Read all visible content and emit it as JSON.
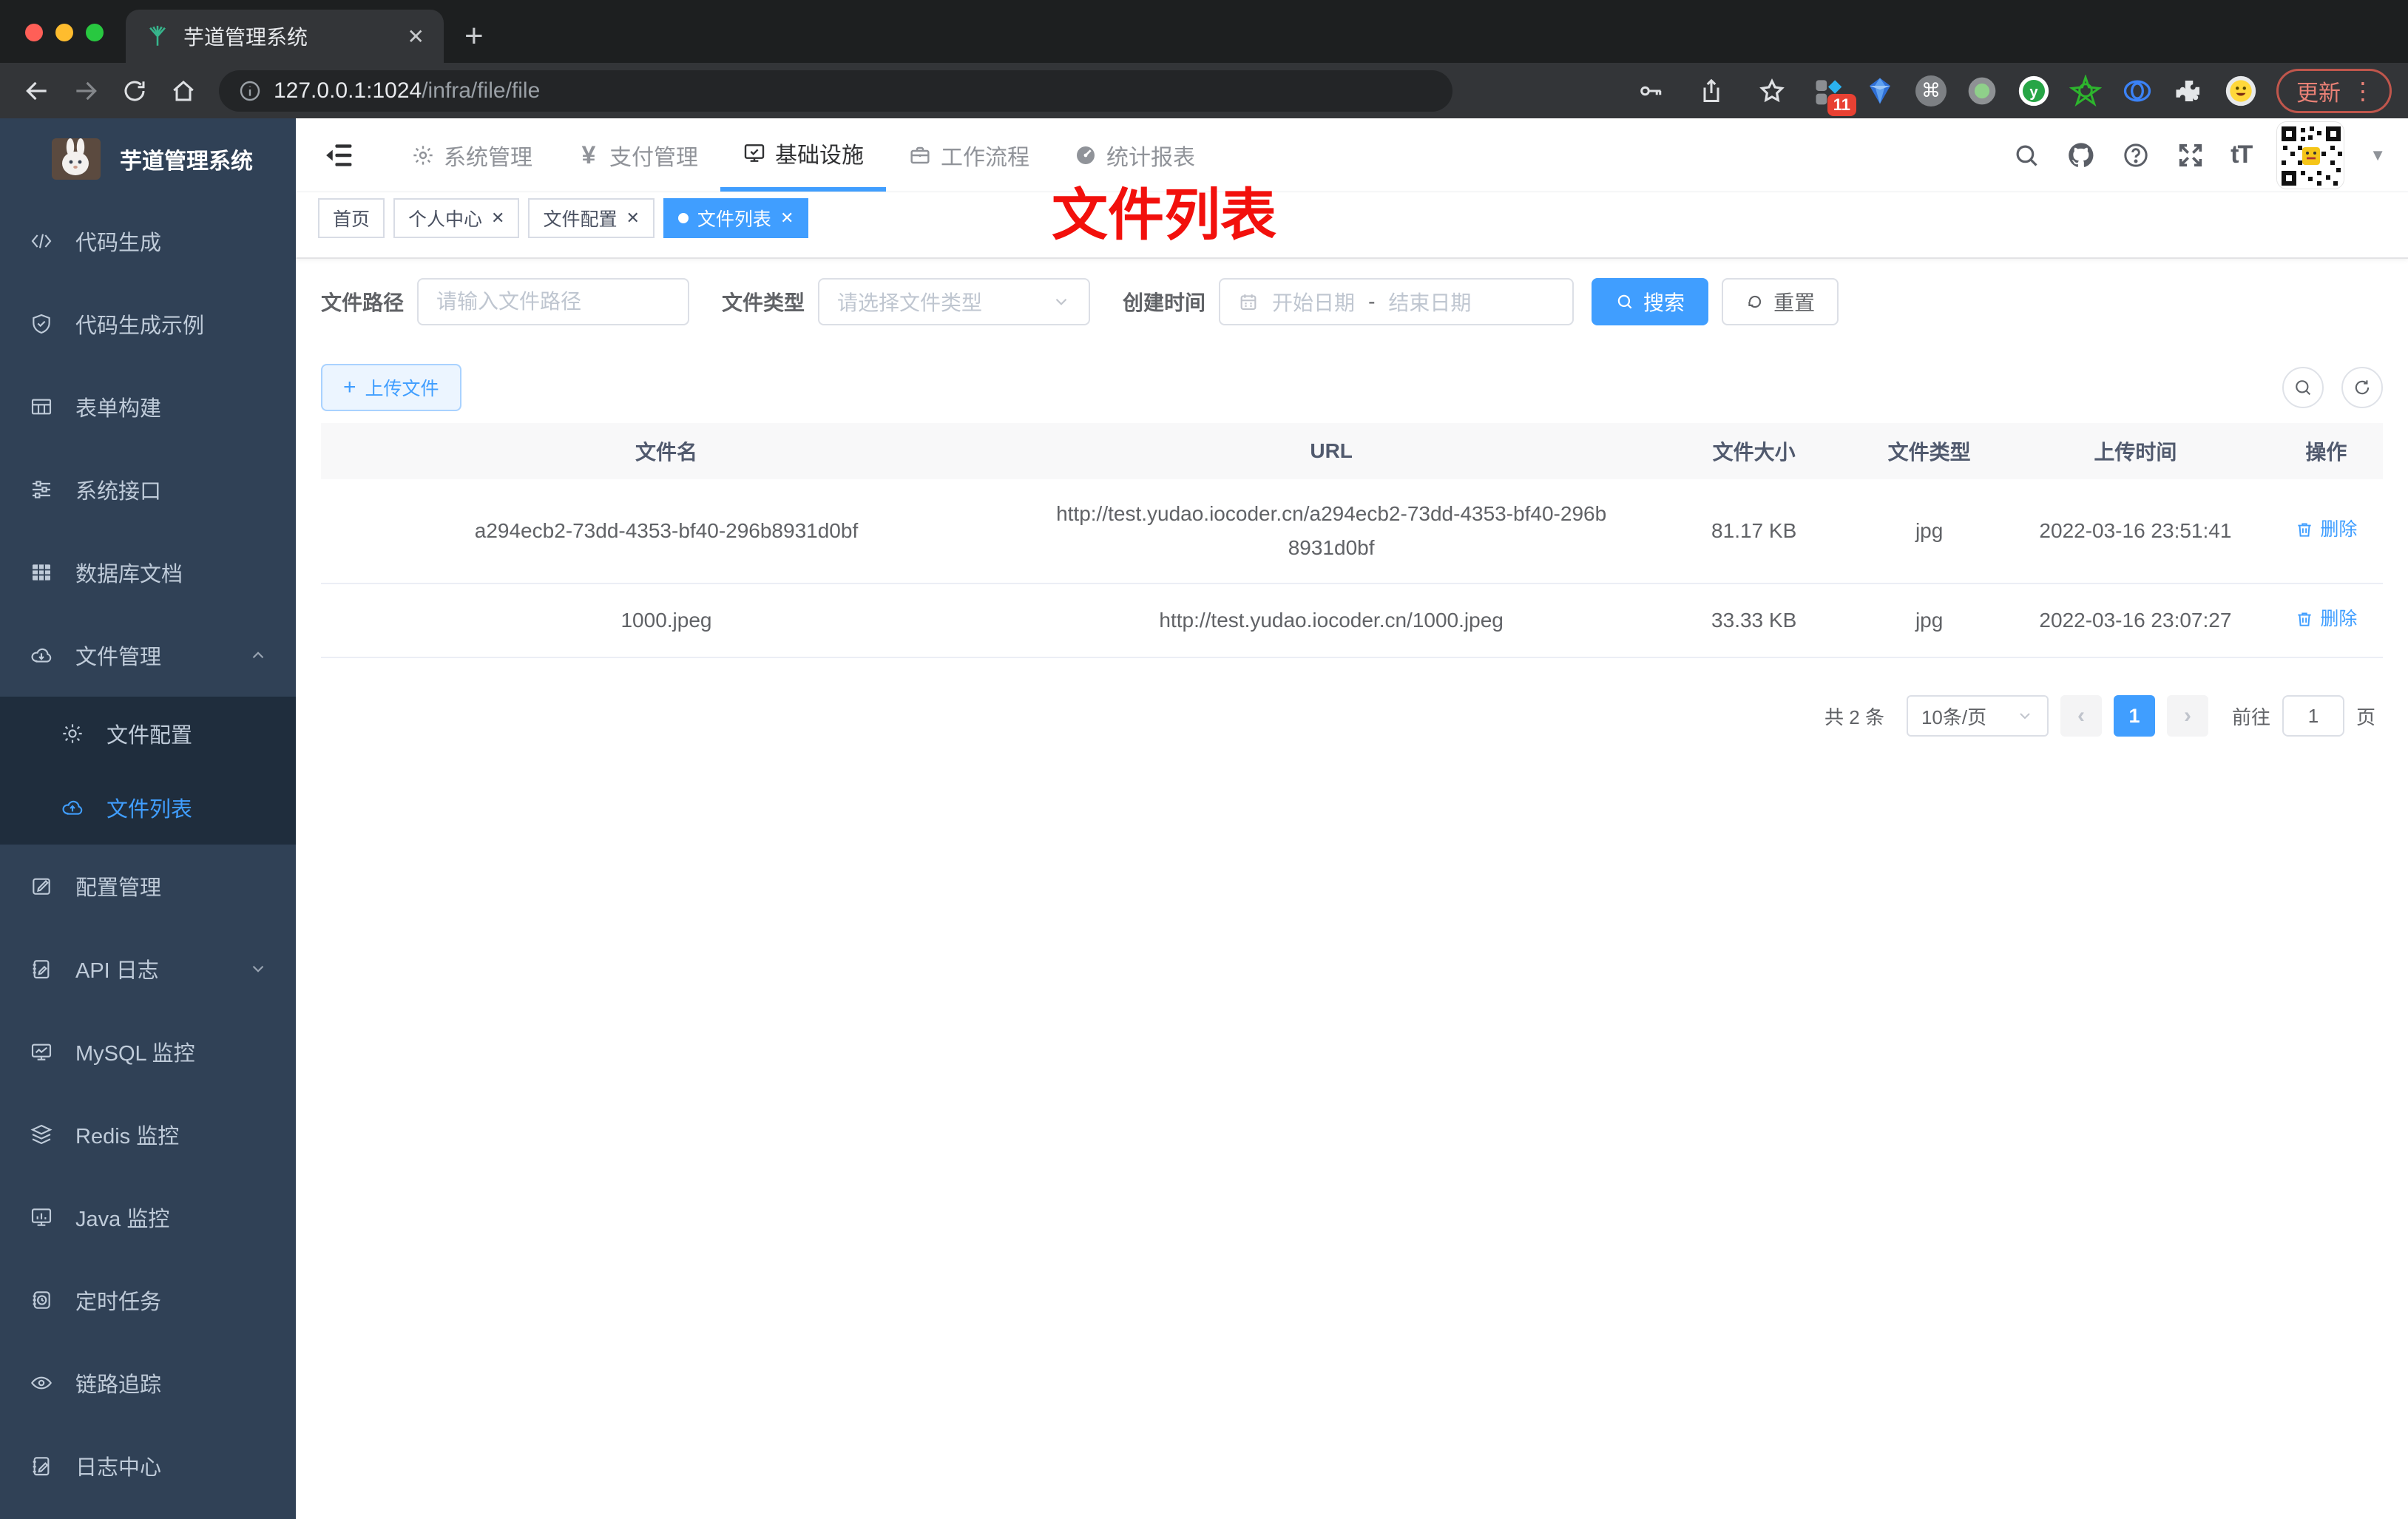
{
  "colors": {
    "accent": "#409eff",
    "sidebar_bg": "#304156",
    "submenu_bg": "#1f2d3d",
    "annotation_red": "#f2100c",
    "update_red": "#ea8176"
  },
  "icons": {
    "close": "✕",
    "plus": "+",
    "prev": "‹",
    "next": "›",
    "caret_down": "▼",
    "kebab": "⋮",
    "yen": "¥",
    "font_size": "tT",
    "command": "⌘",
    "letter_y": "y",
    "info": "i"
  },
  "browser": {
    "tab_title": "芋道管理系统",
    "url_host": "127.0.0.1:1024",
    "url_path": "/infra/file/file",
    "ext_badge": "11",
    "update_label": "更新"
  },
  "sidebar": {
    "title": "芋道管理系统",
    "items": [
      {
        "label": "代码生成"
      },
      {
        "label": "代码生成示例"
      },
      {
        "label": "表单构建"
      },
      {
        "label": "系统接口"
      },
      {
        "label": "数据库文档"
      },
      {
        "label": "文件管理"
      },
      {
        "label": "文件配置"
      },
      {
        "label": "文件列表"
      },
      {
        "label": "配置管理"
      },
      {
        "label": "API 日志"
      },
      {
        "label": "MySQL 监控"
      },
      {
        "label": "Redis 监控"
      },
      {
        "label": "Java 监控"
      },
      {
        "label": "定时任务"
      },
      {
        "label": "链路追踪"
      },
      {
        "label": "日志中心"
      }
    ]
  },
  "topnav": {
    "items": [
      {
        "label": "系统管理"
      },
      {
        "label": "支付管理"
      },
      {
        "label": "基础设施"
      },
      {
        "label": "工作流程"
      },
      {
        "label": "统计报表"
      }
    ]
  },
  "tabs": [
    {
      "label": "首页"
    },
    {
      "label": "个人中心"
    },
    {
      "label": "文件配置"
    },
    {
      "label": "文件列表"
    }
  ],
  "annotation": "文件列表",
  "filters": {
    "path_label": "文件路径",
    "path_placeholder": "请输入文件路径",
    "type_label": "文件类型",
    "type_placeholder": "请选择文件类型",
    "time_label": "创建时间",
    "start_placeholder": "开始日期",
    "range_separator": "-",
    "end_placeholder": "结束日期",
    "search_label": "搜索",
    "reset_label": "重置"
  },
  "actions": {
    "upload_label": "上传文件"
  },
  "table": {
    "headers": [
      "文件名",
      "URL",
      "文件大小",
      "文件类型",
      "上传时间",
      "操作"
    ],
    "rows": [
      {
        "name": "a294ecb2-73dd-4353-bf40-296b8931d0bf",
        "url": "http://test.yudao.iocoder.cn/a294ecb2-73dd-4353-bf40-296b8931d0bf",
        "size": "81.17 KB",
        "type": "jpg",
        "time": "2022-03-16 23:51:41",
        "action": "删除"
      },
      {
        "name": "1000.jpeg",
        "url": "http://test.yudao.iocoder.cn/1000.jpeg",
        "size": "33.33 KB",
        "type": "jpg",
        "time": "2022-03-16 23:07:27",
        "action": "删除"
      }
    ]
  },
  "pagination": {
    "total": "共 2 条",
    "page_size": "10条/页",
    "current_page": "1",
    "goto_label": "前往",
    "goto_value": "1",
    "page_unit": "页"
  }
}
